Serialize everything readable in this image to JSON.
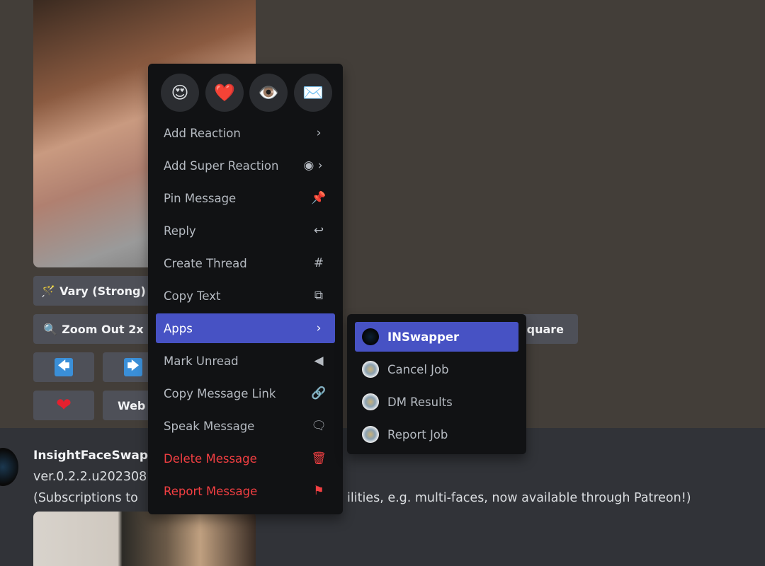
{
  "message_buttons": {
    "vary_strong": "Vary (Strong)",
    "zoom_out": "Zoom Out 2x",
    "square": "Square",
    "web": "Web",
    "left_arrow": "🡄",
    "right_arrow": "🡆",
    "heart": "❤"
  },
  "quick_reactions": [
    "😍",
    "❤️",
    "👁️",
    "✉️"
  ],
  "context_menu": {
    "items": [
      {
        "label": "Add Reaction",
        "icon": "chevron-right",
        "glyph": "›"
      },
      {
        "label": "Add Super Reaction",
        "icon": "super-reaction-chevron",
        "glyph": "◉ ›"
      },
      {
        "label": "Pin Message",
        "icon": "pin",
        "glyph": "📌"
      },
      {
        "label": "Reply",
        "icon": "reply",
        "glyph": "↩"
      },
      {
        "label": "Create Thread",
        "icon": "thread",
        "glyph": "#"
      },
      {
        "label": "Copy Text",
        "icon": "copy",
        "glyph": "⧉"
      },
      {
        "label": "Apps",
        "icon": "chevron-right",
        "glyph": "›"
      },
      {
        "label": "Mark Unread",
        "icon": "mark-unread",
        "glyph": "◀"
      },
      {
        "label": "Copy Message Link",
        "icon": "link",
        "glyph": "🔗"
      },
      {
        "label": "Speak Message",
        "icon": "speak",
        "glyph": "🗨"
      },
      {
        "label": "Delete Message",
        "icon": "trash",
        "glyph": "🗑"
      },
      {
        "label": "Report Message",
        "icon": "flag",
        "glyph": "⚑"
      }
    ]
  },
  "apps_submenu": {
    "items": [
      "INSwapper",
      "Cancel Job",
      "DM Results",
      "Report Job"
    ]
  },
  "message": {
    "author": "InsightFaceSwap",
    "line1": "ver.0.2.2.u202308",
    "line2_start": "(Subscriptions to",
    "line2_end": "ilities, e.g. multi-faces, now available through Patreon!)"
  },
  "colors": {
    "accent": "#4752c4",
    "danger": "#f23f42",
    "menu_bg": "#111214"
  }
}
